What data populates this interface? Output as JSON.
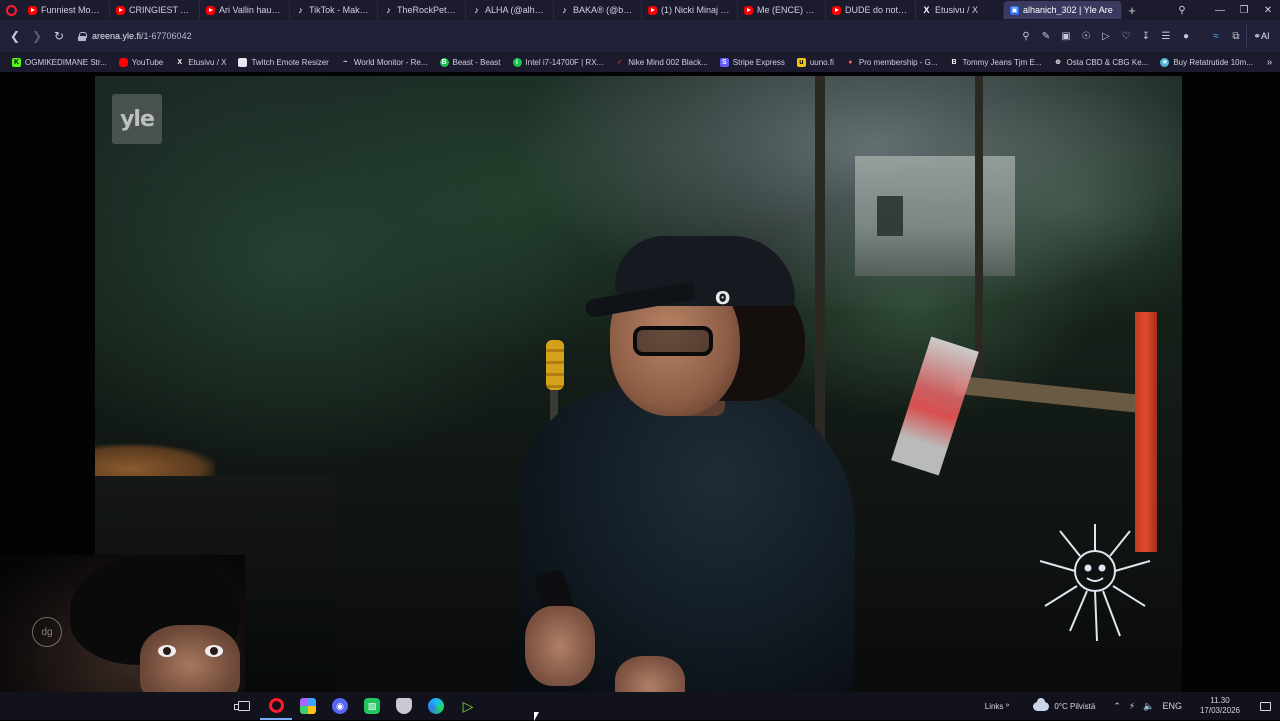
{
  "browser": {
    "tabs": [
      {
        "label": "Funniest Moments",
        "icon": "youtube-icon",
        "kind": "yt"
      },
      {
        "label": "CRINGIEST Audition",
        "icon": "youtube-icon",
        "kind": "yt"
      },
      {
        "label": "Ari Vallin haukkui",
        "icon": "youtube-icon",
        "kind": "yt"
      },
      {
        "label": "TikTok - Make Your",
        "icon": "tiktok-icon",
        "kind": "tt"
      },
      {
        "label": "TheRockPete (@the",
        "icon": "tiktok-icon",
        "kind": "tt"
      },
      {
        "label": "ALHA (@alha) | Tik",
        "icon": "tiktok-icon",
        "kind": "tt"
      },
      {
        "label": "BAKA® (@bakaflo",
        "icon": "tiktok-icon",
        "kind": "tt"
      },
      {
        "label": "(1) Nicki Minaj Call",
        "icon": "youtube-icon",
        "kind": "yt"
      },
      {
        "label": "Me (ENCE) palattiin",
        "icon": "youtube-icon",
        "kind": "yt"
      },
      {
        "label": "DUDE do not do",
        "icon": "youtube-icon",
        "kind": "yt"
      },
      {
        "label": "Etusivu / X",
        "icon": "x-icon",
        "kind": "x"
      },
      {
        "label": "alhanich_302 | Yle Are",
        "icon": "yle-areena-icon",
        "kind": "yle",
        "active": true
      }
    ],
    "url": {
      "host": "areena.yle.fi",
      "path": "/1-67706042"
    },
    "bookmarks": [
      {
        "label": "OGMIKEDIMANE Str...",
        "kind": "kick",
        "glyph": "K"
      },
      {
        "label": "YouTube",
        "kind": "ytb",
        "glyph": ""
      },
      {
        "label": "Etusivu / X",
        "kind": "mono",
        "glyph": "X"
      },
      {
        "label": "Twitch Emote Resizer",
        "kind": "doc",
        "glyph": ""
      },
      {
        "label": "World Monitor - Re...",
        "kind": "mono",
        "glyph": "~"
      },
      {
        "label": "Beast - Beast",
        "kind": "green",
        "glyph": "B"
      },
      {
        "label": "Intel i7-14700F | RX...",
        "kind": "green",
        "glyph": "i"
      },
      {
        "label": "Nike Mind 002 Black...",
        "kind": "nike",
        "glyph": "✓"
      },
      {
        "label": "Stripe Express",
        "kind": "blue",
        "glyph": "S"
      },
      {
        "label": "uuno.fi",
        "kind": "yellow",
        "glyph": "u"
      },
      {
        "label": "Pro membership - G...",
        "kind": "pin",
        "glyph": "●"
      },
      {
        "label": "Tommy Jeans Tjm E...",
        "kind": "mono",
        "glyph": "B"
      },
      {
        "label": "Osta CBD & CBG Ke...",
        "kind": "mono",
        "glyph": "⊕"
      },
      {
        "label": "Buy Retatrutide 10m...",
        "kind": "cbd",
        "glyph": "★"
      }
    ],
    "ai_label": "AI"
  },
  "video": {
    "channel_logo": "yle"
  },
  "taskbar": {
    "links_label": "Links",
    "weather": "0°C  Pilvistä",
    "language": "ENG",
    "time": "11.30",
    "date": "17/03/2026"
  }
}
